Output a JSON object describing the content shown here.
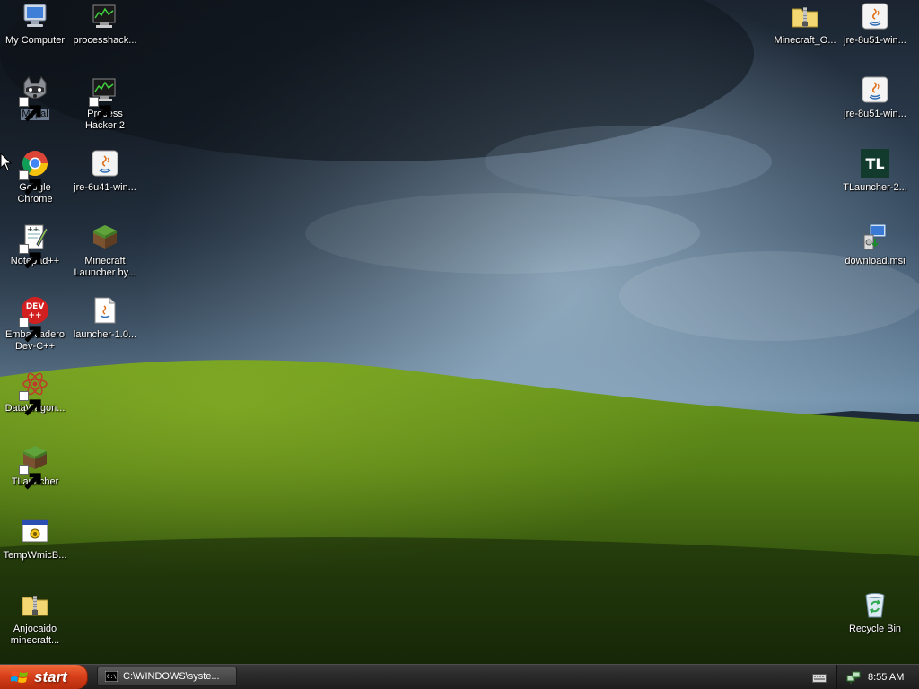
{
  "desktop": {
    "left_column": [
      {
        "label": "My Computer",
        "icon": "my-computer-icon"
      },
      {
        "label": "Mypal",
        "icon": "mypal-raccoon-icon",
        "selected": true
      },
      {
        "label": "Google Chrome",
        "icon": "chrome-icon"
      },
      {
        "label": "Notepad++",
        "icon": "notepad-plus-plus-icon"
      },
      {
        "label": "Embarcadero Dev-C++",
        "icon": "dev-cpp-icon"
      },
      {
        "label": "DataWagon...",
        "icon": "datawagon-icon"
      },
      {
        "label": "TLauncher",
        "icon": "grass-block-icon"
      },
      {
        "label": "TempWmicB...",
        "icon": "batch-file-icon"
      },
      {
        "label": "Anjocaido minecraft...",
        "icon": "zip-folder-icon"
      }
    ],
    "second_column": [
      {
        "label": "processhack...",
        "icon": "process-hacker-icon"
      },
      {
        "label": "Process Hacker 2",
        "icon": "process-hacker-icon"
      },
      {
        "label": "jre-6u41-win...",
        "icon": "java-installer-icon"
      },
      {
        "label": "Minecraft Launcher by...",
        "icon": "grass-block-icon"
      },
      {
        "label": "launcher-1.0...",
        "icon": "java-file-icon"
      }
    ],
    "right_icons": [
      {
        "label": "Minecraft_O...",
        "icon": "zip-folder-icon"
      },
      {
        "label": "jre-8u51-win...",
        "icon": "java-installer-icon"
      },
      {
        "label": "jre-8u51-win...",
        "icon": "java-installer-icon"
      },
      {
        "label": "TLauncher-2...",
        "icon": "tlauncher-icon"
      },
      {
        "label": "download.msi",
        "icon": "msi-installer-icon"
      },
      {
        "label": "Recycle Bin",
        "icon": "recycle-bin-icon"
      }
    ]
  },
  "taskbar": {
    "start_label": "start",
    "tasks": [
      {
        "label": "C:\\WINDOWS\\syste...",
        "icon": "command-prompt-icon"
      }
    ],
    "clock": "8:55 AM"
  },
  "colors": {
    "start": "#d8401a",
    "taskbar": "#2b2b2b",
    "selection": "#6c7b90"
  }
}
